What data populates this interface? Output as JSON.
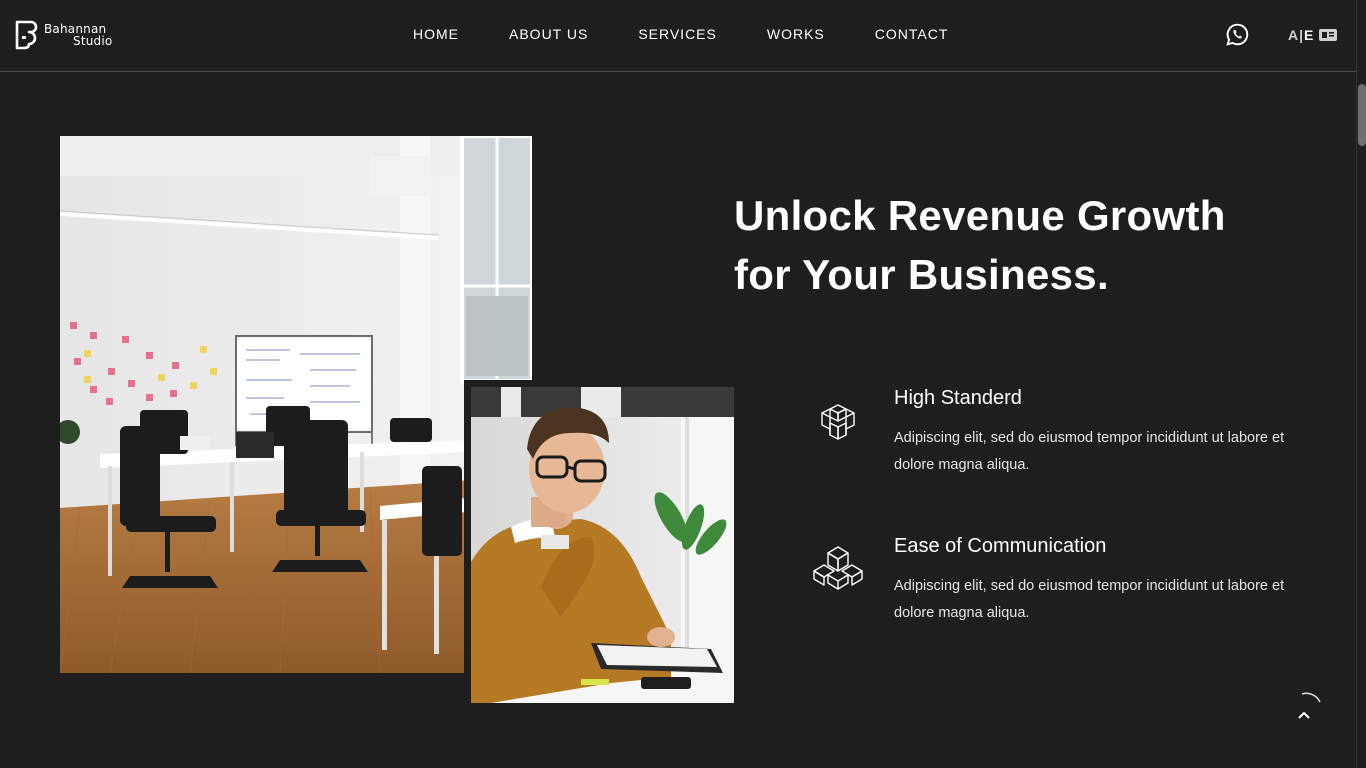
{
  "brand": {
    "line1": "Bahannan",
    "line2": "Studio"
  },
  "nav": {
    "items": [
      "HOME",
      "ABOUT US",
      "SERVICES",
      "WORKS",
      "CONTACT"
    ]
  },
  "header": {
    "lang_a": "A",
    "lang_sep": "|",
    "lang_e": "E",
    "whatsapp_icon": "whatsapp-icon",
    "language_icon": "language-card-icon"
  },
  "hero": {
    "title_line1": "Unlock Revenue Growth",
    "title_line2": "for Your Business."
  },
  "features": [
    {
      "title": "High Standerd",
      "text": "Adipiscing elit, sed do eiusmod tempor incididunt ut labore et dolore magna aliqua.",
      "icon": "cube-structure-icon"
    },
    {
      "title": "Ease of Communication",
      "text": "Adipiscing elit, sed do eiusmod tempor incididunt ut labore et dolore magna aliqua.",
      "icon": "interlocked-cubes-icon"
    }
  ],
  "colors": {
    "background": "#1e1e1e",
    "text": "#ffffff",
    "divider": "#4a4a4a"
  }
}
